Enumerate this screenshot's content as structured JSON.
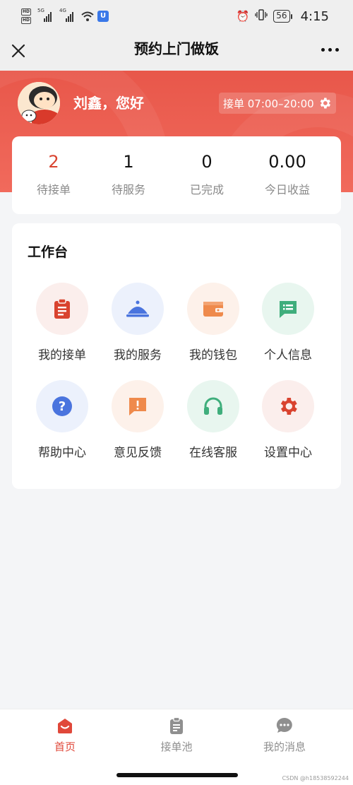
{
  "status_bar": {
    "hd_labels": [
      "HD",
      "HD"
    ],
    "network_left": "5G",
    "network_right": "4G",
    "wifi_label": "6",
    "battery": "56",
    "time": "4:15"
  },
  "nav": {
    "title": "预约上门做饭",
    "close_icon": "close-icon",
    "more_icon": "more-icon"
  },
  "header": {
    "greeting": "刘鑫，您好",
    "hours_label": "接单 07:00–20:00",
    "accent": "#e8574a"
  },
  "stats": [
    {
      "value": "2",
      "label": "待接单"
    },
    {
      "value": "1",
      "label": "待服务"
    },
    {
      "value": "0",
      "label": "已完成"
    },
    {
      "value": "0.00",
      "label": "今日收益"
    }
  ],
  "workbench": {
    "title": "工作台",
    "items": [
      {
        "label": "我的接单",
        "icon": "clipboard-icon"
      },
      {
        "label": "我的服务",
        "icon": "service-bell-icon"
      },
      {
        "label": "我的钱包",
        "icon": "wallet-icon"
      },
      {
        "label": "个人信息",
        "icon": "message-list-icon"
      },
      {
        "label": "帮助中心",
        "icon": "help-icon"
      },
      {
        "label": "意见反馈",
        "icon": "feedback-icon"
      },
      {
        "label": "在线客服",
        "icon": "headset-icon"
      },
      {
        "label": "设置中心",
        "icon": "settings-gear-icon"
      }
    ]
  },
  "tabs": [
    {
      "label": "首页",
      "icon": "home-icon",
      "active": true
    },
    {
      "label": "接单池",
      "icon": "order-pool-icon",
      "active": false
    },
    {
      "label": "我的消息",
      "icon": "chat-icon",
      "active": false
    }
  ],
  "watermark": "CSDN @h18538592244"
}
